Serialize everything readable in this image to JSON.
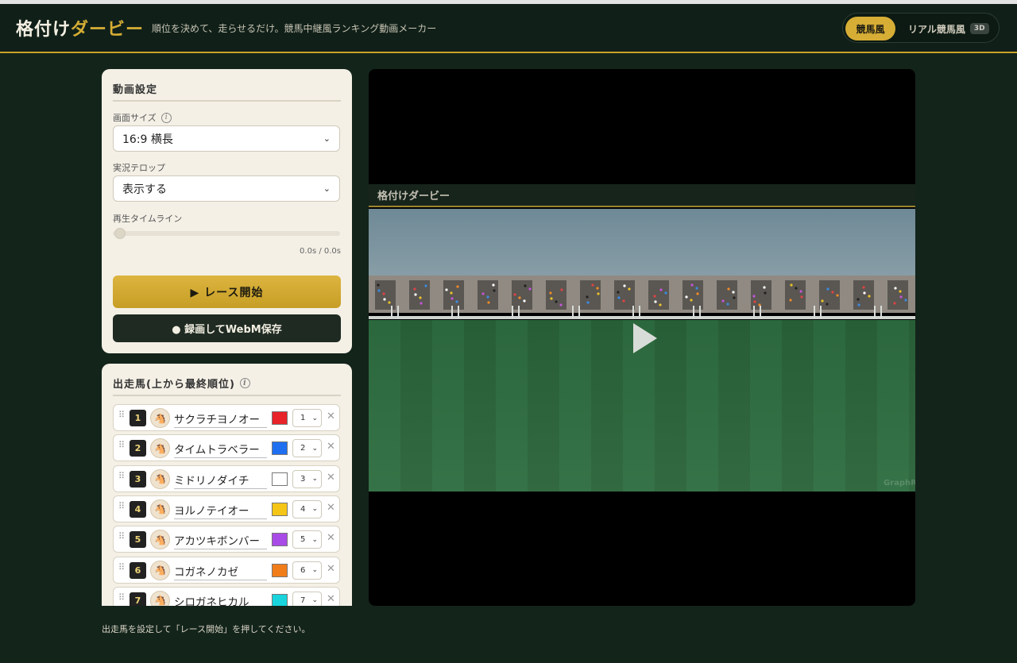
{
  "header": {
    "brand_main": "格付け",
    "brand_accent": "ダービー",
    "tagline": "順位を決めて、走らせるだけ。競馬中継風ランキング動画メーカー",
    "mode_active": "競馬風",
    "mode_other": "リアル競馬風",
    "mode_badge": "3D"
  },
  "settings": {
    "title": "動画設定",
    "size_label": "画面サイズ",
    "size_value": "16:9 横長",
    "telop_label": "実況テロップ",
    "telop_value": "表示する",
    "timeline_label": "再生タイムライン",
    "timeline_progress": 0,
    "time_readout": "0.0s / 0.0s",
    "start_button": "▶ レース開始",
    "record_button": "● 録画してWebM保存"
  },
  "horses": {
    "title": "出走馬(上から最終順位)",
    "items": [
      {
        "num": "1",
        "name": "サクラチヨノオー",
        "color": "#e8232a",
        "rank": "1"
      },
      {
        "num": "2",
        "name": "タイムトラベラー",
        "color": "#1f6ff0",
        "rank": "2"
      },
      {
        "num": "3",
        "name": "ミドリノダイチ",
        "color": "#ffffff",
        "rank": "3"
      },
      {
        "num": "4",
        "name": "ヨルノテイオー",
        "color": "#f5c518",
        "rank": "4"
      },
      {
        "num": "5",
        "name": "アカツキボンバー",
        "color": "#a94be6",
        "rank": "5"
      },
      {
        "num": "6",
        "name": "コガネノカゼ",
        "color": "#f07d1a",
        "rank": "6"
      },
      {
        "num": "7",
        "name": "シロガネヒカル",
        "color": "#19d4dc",
        "rank": "7"
      }
    ]
  },
  "stage": {
    "title": "格付けダービー",
    "watermark": "GraphRe"
  },
  "footer": {
    "note": "出走馬を設定して「レース開始」を押してください。"
  }
}
